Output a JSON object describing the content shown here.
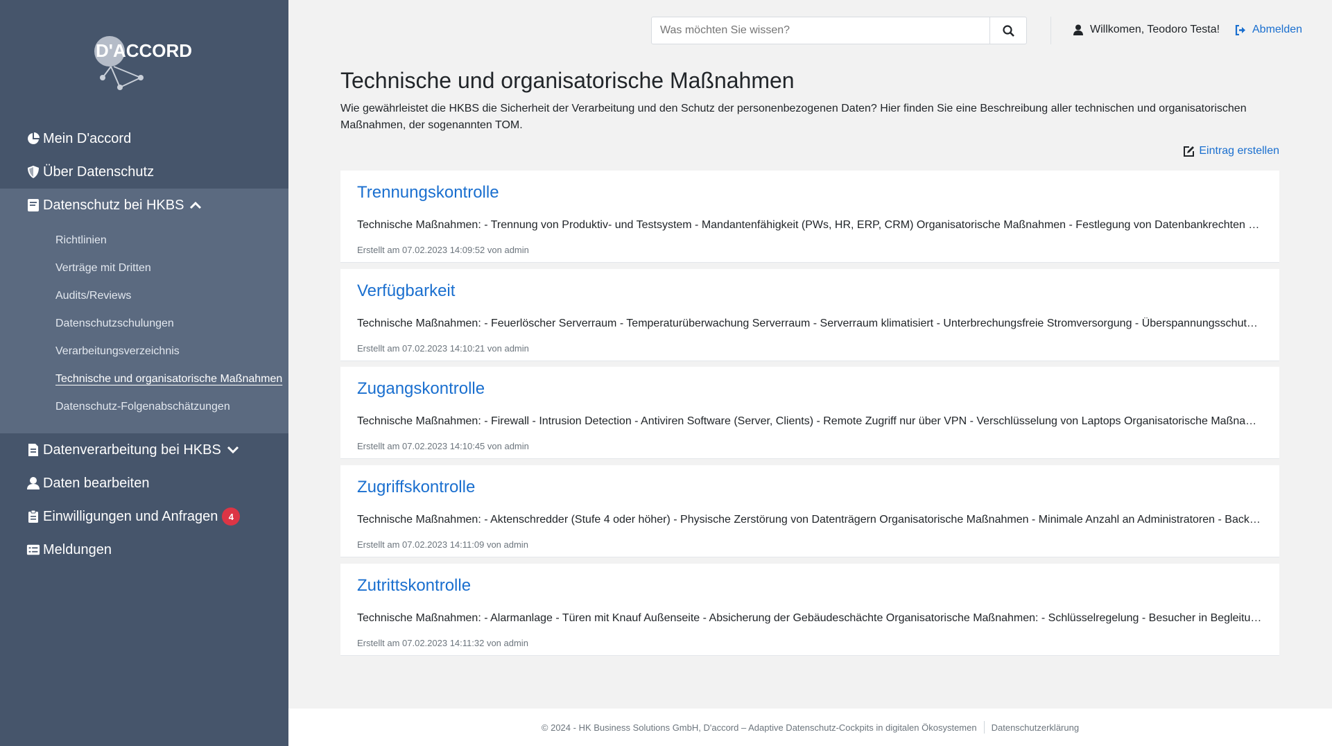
{
  "brand": {
    "logo_text": "D'ACCORD"
  },
  "sidebar": {
    "items": [
      {
        "label": "Mein D'accord",
        "icon": "pie-chart-icon"
      },
      {
        "label": "Über Datenschutz",
        "icon": "shield-icon"
      },
      {
        "label": "Datenschutz bei HKBS",
        "icon": "book-icon"
      },
      {
        "label": "Datenverarbeitung bei HKBS",
        "icon": "document-icon"
      },
      {
        "label": "Daten bearbeiten",
        "icon": "user-icon"
      },
      {
        "label": "Einwilligungen und Anfragen",
        "icon": "clipboard-icon",
        "badge": "4"
      },
      {
        "label": "Meldungen",
        "icon": "list-icon"
      }
    ],
    "submenu": [
      "Richtlinien",
      "Verträge mit Dritten",
      "Audits/Reviews",
      "Datenschutzschulungen",
      "Verarbeitungsverzeichnis",
      "Technische und organisatorische Maßnahmen",
      "Datenschutz-Folgenabschätzungen"
    ]
  },
  "header": {
    "search_placeholder": "Was möchten Sie wissen?",
    "welcome": "Willkomen, Teodoro Testa!",
    "logout": "Abmelden"
  },
  "main": {
    "title": "Technische und organisatorische Maßnahmen",
    "intro": "Wie gewährleistet die HKBS die Sicherheit der Verarbeitung und den Schutz der personenbezogenen Daten? Hier finden Sie eine Beschreibung aller technischen und organisatorischen Maßnahmen, der sogenannten TOM.",
    "create_label": "Eintrag erstellen",
    "entries": [
      {
        "title": "Trennungskontrolle",
        "text": "Technische Maßnahmen: - Trennung von Produktiv- und Testsystem - Mandantenfähigkeit (PWs, HR, ERP, CRM) Organisatorische Maßnahmen - Festlegung von Datenbankrechten durch Berechtigungskonzept",
        "meta": "Erstellt am 07.02.2023 14:09:52 von admin"
      },
      {
        "title": "Verfügbarkeit",
        "text": "Technische Maßnahmen: - Feuerlöscher Serverraum - Temperaturüberwachung Serverraum - Serverraum klimatisiert - Unterbrechungsfreie Stromversorgung - Überspannungsschutz - Backup",
        "meta": "Erstellt am 07.02.2023 14:10:21 von admin"
      },
      {
        "title": "Zugangskontrolle",
        "text": "Technische Maßnahmen: - Firewall - Intrusion Detection - Antiviren Software (Server, Clients) - Remote Zugriff nur über VPN - Verschlüsselung von Laptops Organisatorische Maßnahmen",
        "meta": "Erstellt am 07.02.2023 14:10:45 von admin"
      },
      {
        "title": "Zugriffskontrolle",
        "text": "Technische Maßnahmen: - Aktenschredder (Stufe 4 oder höher) - Physische Zerstörung von Datenträgern Organisatorische Maßnahmen - Minimale Anzahl an Administratoren - Backup-Konzept",
        "meta": "Erstellt am 07.02.2023 14:11:09 von admin"
      },
      {
        "title": "Zutrittskontrolle",
        "text": "Technische Maßnahmen: - Alarmanlage - Türen mit Knauf Außenseite - Absicherung der Gebäudeschächte Organisatorische Maßnahmen: - Schlüsselregelung - Besucher in Begleitung durch Mitarbeiter",
        "meta": "Erstellt am 07.02.2023 14:11:32 von admin"
      }
    ]
  },
  "footer": {
    "copyright": "© 2024 - HK Business Solutions GmbH, D'accord – Adaptive Datenschutz-Cockpits in digitalen Ökosystemen",
    "privacy_link": "Datenschutzerklärung"
  },
  "colors": {
    "sidebar": "#46556b",
    "sidebar_active": "#5b6a80",
    "link": "#1a6fcf",
    "badge": "#dc3545"
  }
}
